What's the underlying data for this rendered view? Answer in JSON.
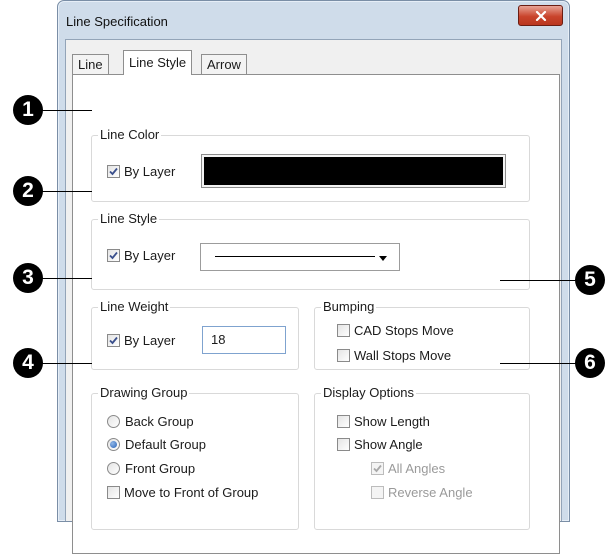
{
  "dialog": {
    "title": "Line Specification",
    "close_icon": "close-x-icon",
    "titlebar_accent": "#c9442c"
  },
  "tabs": [
    {
      "label": "Line",
      "active": false
    },
    {
      "label": "Line Style",
      "active": true
    },
    {
      "label": "Arrow",
      "active": false
    }
  ],
  "line_color": {
    "title": "Line Color",
    "by_layer_label": "By Layer",
    "by_layer_checked": true,
    "color_value": "#000000"
  },
  "line_style": {
    "title": "Line Style",
    "by_layer_label": "By Layer",
    "by_layer_checked": true,
    "selected_style": "solid"
  },
  "line_weight": {
    "title": "Line Weight",
    "by_layer_label": "By Layer",
    "by_layer_checked": true,
    "value": "18"
  },
  "bumping": {
    "title": "Bumping",
    "cad_stops_move_label": "CAD Stops Move",
    "cad_stops_move_checked": false,
    "wall_stops_move_label": "Wall Stops Move",
    "wall_stops_move_checked": false
  },
  "drawing_group": {
    "title": "Drawing Group",
    "options": [
      {
        "label": "Back Group",
        "selected": false
      },
      {
        "label": "Default Group",
        "selected": true
      },
      {
        "label": "Front Group",
        "selected": false
      }
    ],
    "move_to_front_label": "Move to Front of Group",
    "move_to_front_checked": false
  },
  "display_options": {
    "title": "Display Options",
    "show_length_label": "Show Length",
    "show_length_checked": false,
    "show_angle_label": "Show Angle",
    "show_angle_checked": false,
    "all_angles_label": "All Angles",
    "all_angles_checked": true,
    "all_angles_enabled": false,
    "reverse_angle_label": "Reverse Angle",
    "reverse_angle_checked": false,
    "reverse_angle_enabled": false
  },
  "callouts": [
    "1",
    "2",
    "3",
    "4",
    "5",
    "6"
  ]
}
